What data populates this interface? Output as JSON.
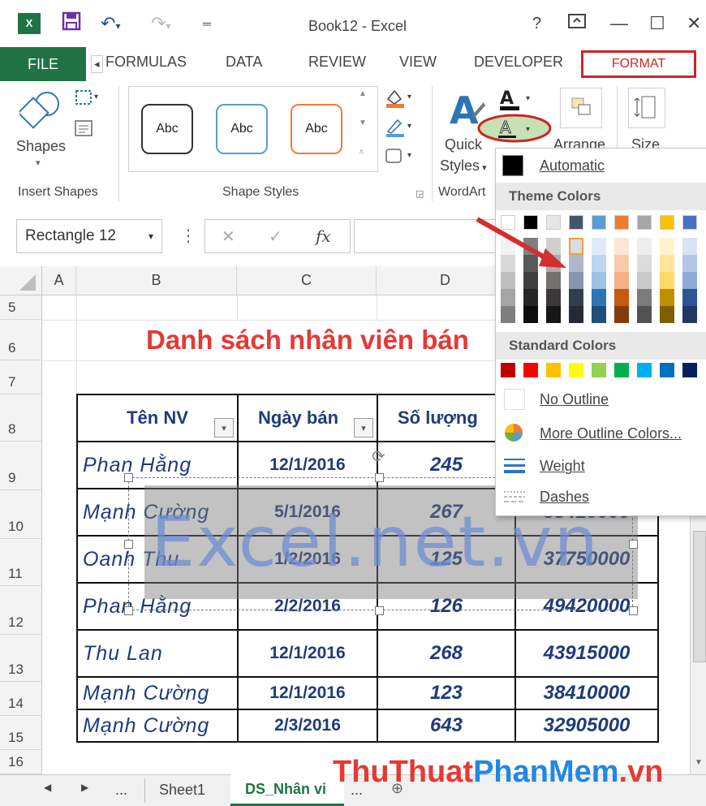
{
  "titlebar": {
    "title": "Book12 - Excel",
    "help": "?",
    "app_icon": "excel-icon"
  },
  "tabs": {
    "file": "FILE",
    "formulas": "FORMULAS",
    "data": "DATA",
    "review": "REVIEW",
    "view": "VIEW",
    "developer": "DEVELOPER",
    "format": "FORMAT"
  },
  "ribbon": {
    "shapes_label": "Shapes",
    "insert_shapes": "Insert Shapes",
    "shape_styles": "Shape Styles",
    "style_abc": "Abc",
    "wordart": "WordArt",
    "quick": "Quick",
    "styles": "Styles",
    "arrange": "Arrange",
    "size": "Size",
    "style_border_colors": [
      "#333333",
      "#5b9bd5",
      "#ed7d31"
    ]
  },
  "formula_bar": {
    "name_box": "Rectangle 12",
    "fx": "fx"
  },
  "sheet": {
    "columns": [
      "A",
      "B",
      "C",
      "D"
    ],
    "rows": [
      "5",
      "6",
      "7",
      "8",
      "9",
      "10",
      "11",
      "12",
      "13",
      "14",
      "15",
      "16"
    ],
    "title": "Danh sách nhân viên bán",
    "headers": [
      "Tên NV",
      "Ngày bán",
      "Số lượng",
      ""
    ],
    "data": [
      [
        "Phan Hằng",
        "12/1/2016",
        "245",
        ""
      ],
      [
        "Mạnh Cường",
        "5/1/2016",
        "267",
        "38410000"
      ],
      [
        "Oanh Thu",
        "1/2/2016",
        "125",
        "37750000"
      ],
      [
        "Phan Hằng",
        "2/2/2016",
        "126",
        "49420000"
      ],
      [
        "Thu Lan",
        "12/1/2016",
        "268",
        "43915000"
      ],
      [
        "Mạnh Cường",
        "12/1/2016",
        "123",
        "38410000"
      ],
      [
        "Mạnh Cường",
        "2/3/2016",
        "643",
        "32905000"
      ]
    ],
    "shape_text": "Excel.net.vn"
  },
  "dropdown": {
    "automatic": "Automatic",
    "theme_colors": "Theme Colors",
    "standard_colors": "Standard Colors",
    "no_outline": "No Outline",
    "more_colors": "More Outline Colors...",
    "weight": "Weight",
    "dashes": "Dashes",
    "theme_top": [
      "#ffffff",
      "#000000",
      "#e7e6e6",
      "#44546a",
      "#5b9bd5",
      "#ed7d31",
      "#a5a5a5",
      "#ffc000",
      "#4472c4"
    ],
    "theme_shades": [
      [
        "#f2f2f2",
        "#7f7f7f",
        "#d0cece",
        "#d6dce4",
        "#deebf6",
        "#fbe5d5",
        "#ededed",
        "#fff2cc",
        "#dae3f3"
      ],
      [
        "#d8d8d8",
        "#595959",
        "#aeabab",
        "#adb9ca",
        "#bdd7ee",
        "#f7cbac",
        "#dbdbdb",
        "#fee599",
        "#b4c6e7"
      ],
      [
        "#bfbfbf",
        "#3f3f3f",
        "#757070",
        "#8496b0",
        "#9cc3e5",
        "#f4b183",
        "#c9c9c9",
        "#ffd965",
        "#8eaadb"
      ],
      [
        "#a5a5a5",
        "#262626",
        "#3a3838",
        "#323f4f",
        "#2e75b5",
        "#c55a11",
        "#7b7b7b",
        "#bf9000",
        "#2f5496"
      ],
      [
        "#7f7f7f",
        "#0c0c0c",
        "#171616",
        "#222a35",
        "#1e4e79",
        "#833c0b",
        "#525252",
        "#7f6000",
        "#1f3864"
      ]
    ],
    "standard": [
      "#c00000",
      "#ff0000",
      "#ffc000",
      "#ffff00",
      "#92d050",
      "#00b050",
      "#00b0f0",
      "#0070c0",
      "#002060"
    ]
  },
  "sheetbar": {
    "ellipsis": "...",
    "sheet1": "Sheet1",
    "active": "DS_Nhân vi",
    "more": "..."
  },
  "watermark": {
    "part1": "ThuThuat",
    "part2": "PhanMem",
    "part3": ".vn"
  }
}
